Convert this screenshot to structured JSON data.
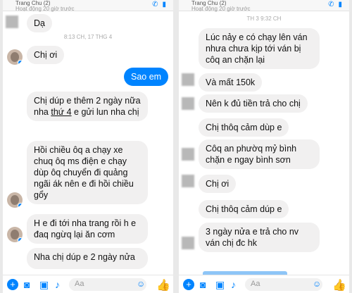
{
  "left": {
    "topbar": {
      "name": "Trang Chu (2)",
      "status": "Hoạt động 20 giờ trước"
    },
    "messages": [
      {
        "text": "Dạ"
      },
      {
        "timestamp": "8:13 CH, 17 THG 4"
      },
      {
        "text": "Chị ơi"
      },
      {
        "text": "Sao em"
      },
      {
        "text_a": "Chị dúp e thêm 2 ngày nữa nha ",
        "text_u": "thứ 4",
        "text_b": " e gửi lun nha chị"
      },
      {
        "text": "Hồi chiều ôq a chạy xe chuq ôq ms điện e chạy dùp ôq chuyển đi quảng ngãi ák nên e đi hồi chiều gổy"
      },
      {
        "text": "H e đi tới nha trang rồi h e đaq ngừq lại ăn cơm"
      },
      {
        "text": "Nha chị dúp e 2 ngày nửa"
      }
    ],
    "composer": {
      "placeholder": "Aa"
    }
  },
  "right": {
    "topbar": {
      "name": "Trang Chu (2)",
      "status": "Hoạt động 20 giờ trước"
    },
    "messages": [
      {
        "timestamp": "TH 3 9:32 CH"
      },
      {
        "text": "Lúc nảy e có chạy lên ván nhưa chưa kịp tới ván bị côq an chặn lại"
      },
      {
        "text": "Và mất 150k"
      },
      {
        "text": "Nên k đủ tiền trả cho chị"
      },
      {
        "text": "Chị thôq cảm dùp e"
      },
      {
        "text": "Côq an phườq mỷ bình chặn e ngay bình sơn"
      },
      {
        "text": "Chị ơi"
      },
      {
        "text": "Chị thôq cảm dúp e"
      },
      {
        "text": "3 ngày nửa e trả cho nv ván chị đc hk"
      }
    ],
    "composer": {
      "placeholder": "Aa"
    }
  },
  "icons": {
    "plus": "plus-icon",
    "camera": "camera-icon",
    "image": "image-icon",
    "mic": "mic-icon",
    "emoji": "emoji-icon",
    "like": "thumbs-up-icon",
    "phone": "phone-icon",
    "video": "video-icon"
  },
  "colors": {
    "accent": "#0084ff",
    "bubble_in": "#f1f0f0"
  }
}
